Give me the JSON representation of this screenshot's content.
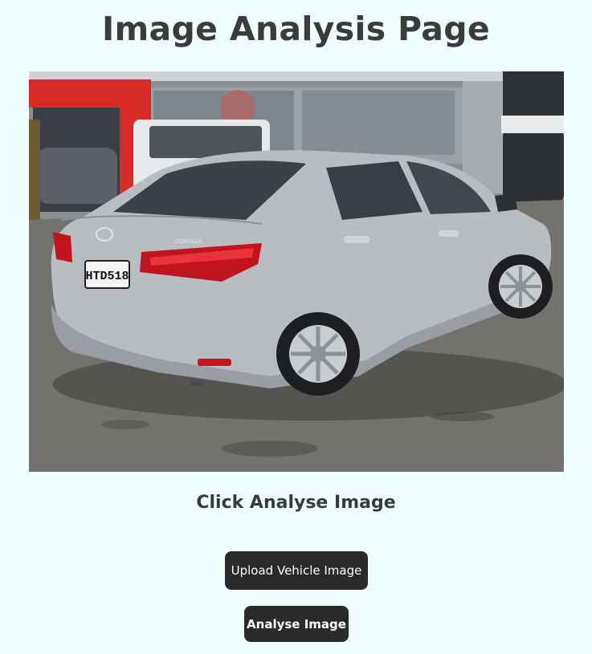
{
  "page": {
    "title": "Image Analysis Page",
    "instruction": "Click Analyse Image"
  },
  "vehicle_image": {
    "plate": "HTD518",
    "badge": "COROLLA"
  },
  "buttons": {
    "upload_label": "Upload Vehicle Image",
    "analyse_label": "Analyse Image"
  },
  "colors": {
    "background": "#f0fffe",
    "button": "#2b2a2a",
    "text": "#3a3a3a"
  }
}
